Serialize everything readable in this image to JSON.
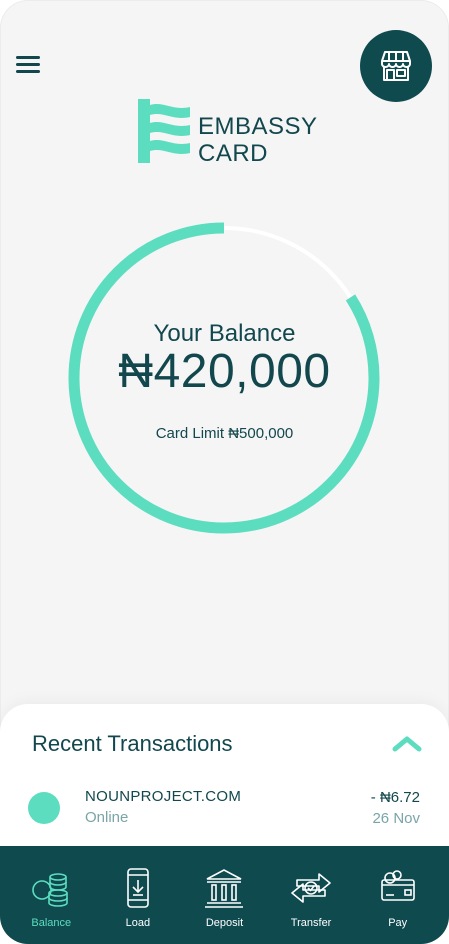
{
  "colors": {
    "primary_dark": "#0f4a4f",
    "accent": "#5dddbf",
    "text": "#12474d",
    "muted_text": "#7aa5a8",
    "background": "#f5f5f5"
  },
  "header": {
    "menu_icon": "hamburger-menu-icon",
    "store_icon": "storefront-icon",
    "logo_text": "EMBASSY\nCARD"
  },
  "balance": {
    "label": "Your Balance",
    "amount": "₦420,000",
    "card_limit_text": "Card Limit ₦500,000",
    "balance_value": 420000,
    "limit_value": 500000
  },
  "transactions": {
    "title": "Recent Transactions",
    "toggle_icon": "chevron-up-icon",
    "items": [
      {
        "merchant": "NOUNPROJECT.COM",
        "method": "Online",
        "amount": "- ₦6.72",
        "date": "26 Nov"
      }
    ]
  },
  "nav": {
    "items": [
      {
        "label": "Balance",
        "icon": "coins-icon",
        "active": true
      },
      {
        "label": "Load",
        "icon": "phone-download-icon",
        "active": false
      },
      {
        "label": "Deposit",
        "icon": "bank-icon",
        "active": false
      },
      {
        "label": "Transfer",
        "icon": "transfer-arrows-icon",
        "active": false
      },
      {
        "label": "Pay",
        "icon": "card-coins-icon",
        "active": false
      }
    ]
  }
}
